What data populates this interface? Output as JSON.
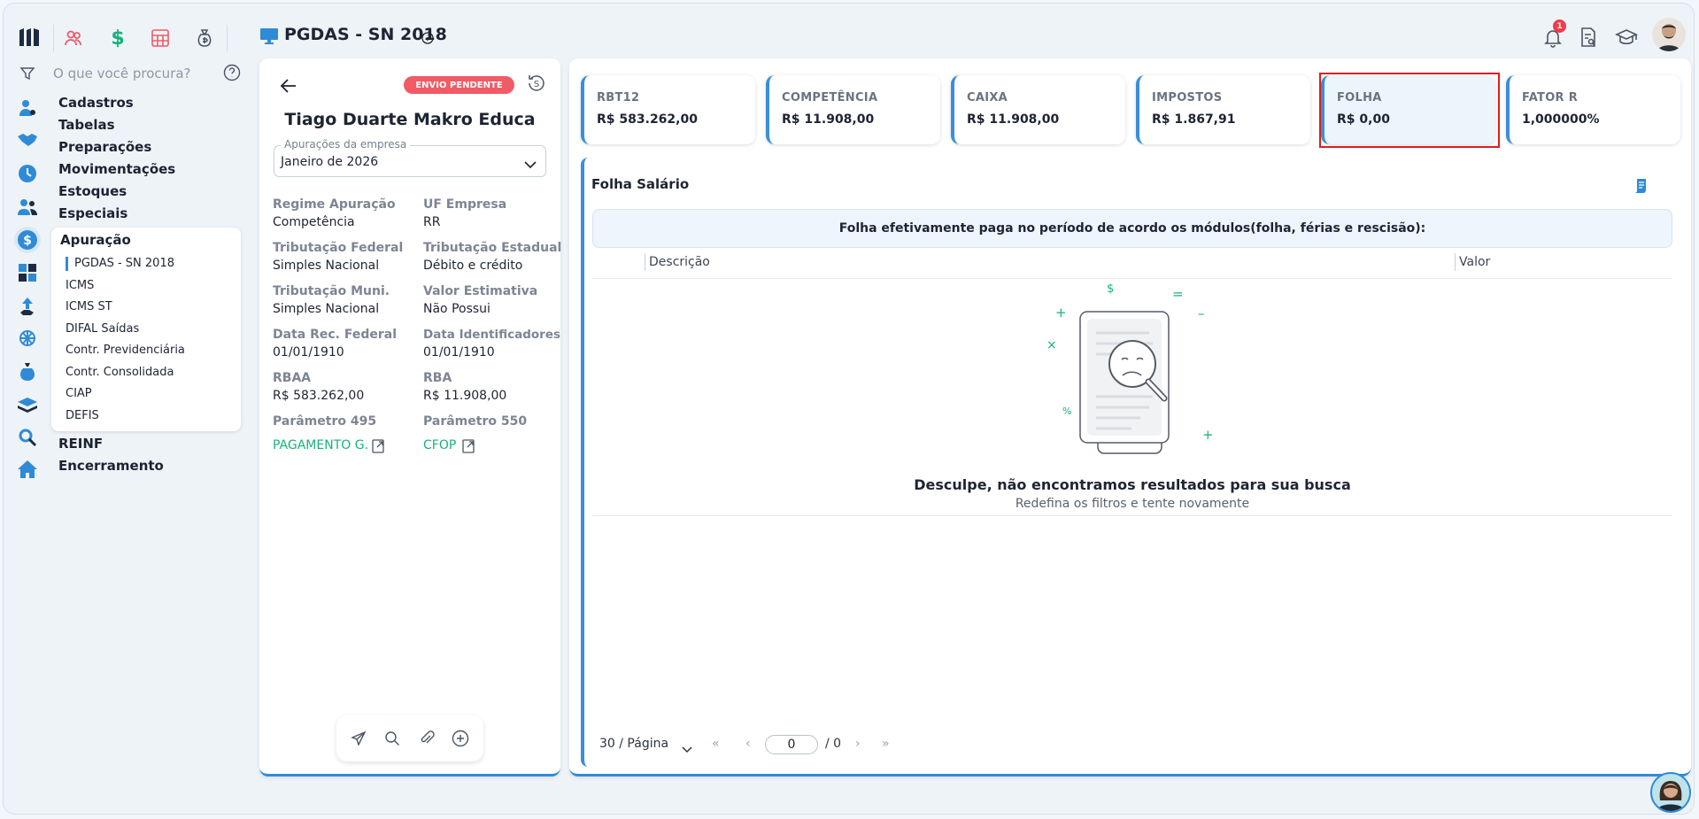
{
  "header": {
    "title": "PGDAS - SN 2018",
    "notification_count": "1"
  },
  "sidebar": {
    "search_placeholder": "O que você procura?",
    "menu": [
      "Cadastros",
      "Tabelas",
      "Preparações",
      "Movimentações",
      "Estoques",
      "Especiais",
      "Apuração"
    ],
    "submenu": [
      "PGDAS - SN 2018",
      "ICMS",
      "ICMS ST",
      "DIFAL Saídas",
      "Contr. Previdenciária",
      "Contr. Consolidada",
      "CIAP",
      "DEFIS"
    ],
    "menu_after": [
      "REINF",
      "Encerramento"
    ]
  },
  "company": {
    "status_badge": "ENVIO PENDENTE",
    "name": "Tiago Duarte Makro Educa",
    "select_legend": "Apurações da empresa",
    "select_value": "Janeiro de 2026",
    "fields": [
      {
        "label": "Regime Apuração",
        "value": "Competência"
      },
      {
        "label": "UF Empresa",
        "value": "RR"
      },
      {
        "label": "Tributação Federal",
        "value": "Simples Nacional"
      },
      {
        "label": "Tributação Estadual",
        "value": "Débito e crédito"
      },
      {
        "label": "Tributação Muni.",
        "value": "Simples Nacional"
      },
      {
        "label": "Valor Estimativa",
        "value": "Não Possui"
      },
      {
        "label": "Data Rec. Federal",
        "value": "01/01/1910"
      },
      {
        "label": "Data Identificadores",
        "value": "01/01/1910"
      },
      {
        "label": "RBAA",
        "value": "R$ 583.262,00"
      },
      {
        "label": "RBA",
        "value": "R$ 11.908,00"
      },
      {
        "label": "Parâmetro 495",
        "value": "PAGAMENTO G."
      },
      {
        "label": "Parâmetro 550",
        "value": "CFOP"
      }
    ]
  },
  "kpis": [
    {
      "title": "RBT12",
      "value": "R$ 583.262,00"
    },
    {
      "title": "COMPETÊNCIA",
      "value": "R$ 11.908,00"
    },
    {
      "title": "CAIXA",
      "value": "R$ 11.908,00"
    },
    {
      "title": "IMPOSTOS",
      "value": "R$ 1.867,91"
    },
    {
      "title": "FOLHA",
      "value": "R$ 0,00"
    },
    {
      "title": "FATOR R",
      "value": "1,000000%"
    }
  ],
  "panel": {
    "title": "Folha Salário",
    "info": "Folha efetivamente paga no período de acordo os módulos(folha, férias e rescisão):",
    "columns": [
      "Descrição",
      "Valor"
    ],
    "empty_title": "Desculpe, não encontramos resultados para sua busca",
    "empty_subtitle": "Redefina os filtros e tente novamente"
  },
  "pagination": {
    "page_size_label": "30 / Página",
    "current_page": "0",
    "total_label": "/ 0"
  },
  "colors": {
    "accent": "#2f8bd6",
    "badge": "#f05b66",
    "link": "#14b37a",
    "highlight": "#e01d1d"
  }
}
